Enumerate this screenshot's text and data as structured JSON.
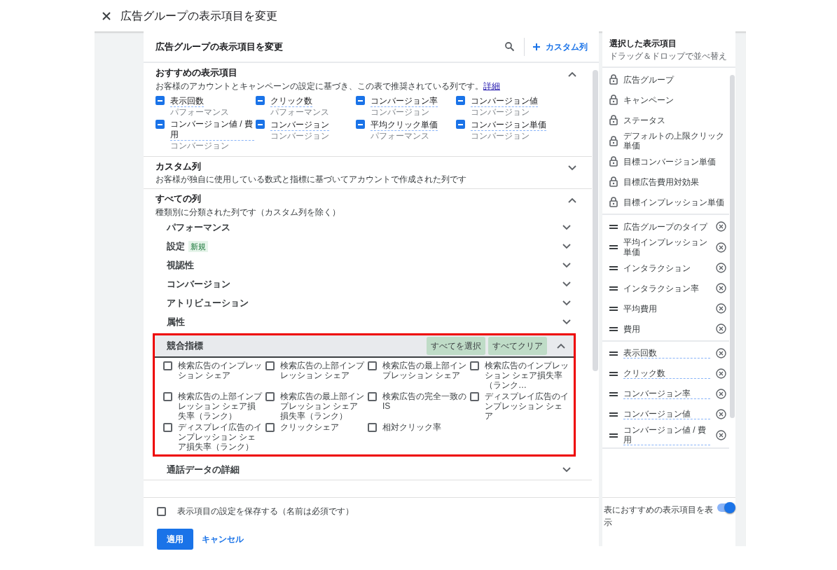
{
  "header": {
    "title": "広告グループの表示項目を変更"
  },
  "panel": {
    "title": "広告グループの表示項目を変更",
    "custom_column_button": "カスタム列"
  },
  "sections": [
    {
      "kind": "recommended",
      "title": "おすすめの表示項目",
      "description": "お客様のアカウントとキャンペーンの設定に基づき、この表で推奨されている列です。",
      "link": "詳細",
      "expanded": true,
      "items": [
        {
          "label": "表示回数",
          "category": "パフォーマンス",
          "checked": true
        },
        {
          "label": "クリック数",
          "category": "パフォーマンス",
          "checked": true
        },
        {
          "label": "コンバージョン率",
          "category": "コンバージョン",
          "checked": true
        },
        {
          "label": "コンバージョン値",
          "category": "コンバージョン",
          "checked": true
        },
        {
          "label": "コンバージョン値 / 費用",
          "category": "コンバージョン",
          "checked": true
        },
        {
          "label": "コンバージョン",
          "category": "コンバージョン",
          "checked": true
        },
        {
          "label": "平均クリック単価",
          "category": "パフォーマンス",
          "checked": true
        },
        {
          "label": "コンバージョン単価",
          "category": "コンバージョン",
          "checked": true
        }
      ]
    },
    {
      "kind": "plain",
      "title": "カスタム列",
      "description": "お客様が独自に使用している数式と指標に基づいてアカウントで作成された列です",
      "expanded": false
    },
    {
      "kind": "categories",
      "title": "すべての列",
      "description": "種類別に分類された列です（カスタム列を除く）",
      "expanded": true,
      "categories": [
        {
          "label": "パフォーマンス",
          "expanded": false
        },
        {
          "label": "設定",
          "badge": "新規",
          "expanded": false
        },
        {
          "label": "視認性",
          "expanded": false
        },
        {
          "label": "コンバージョン",
          "expanded": false
        },
        {
          "label": "アトリビューション",
          "expanded": false
        },
        {
          "label": "属性",
          "expanded": false
        },
        {
          "label": "競合指標",
          "expanded": true,
          "highlighted": true,
          "select_all": "すべてを選択",
          "clear_all": "すべてクリア",
          "items": [
            {
              "label": "検索広告のインプレッション シェア",
              "checked": false
            },
            {
              "label": "検索広告の上部インプレッション シェア",
              "checked": false
            },
            {
              "label": "検索広告の最上部インプレッション シェア",
              "checked": false
            },
            {
              "label": "検索広告のインプレッション シェア損失率（ランク…",
              "checked": false
            },
            {
              "label": "検索広告の上部インプレッション シェア損失率（ランク）",
              "checked": false
            },
            {
              "label": "検索広告の最上部インプレッション シェア損失率（ランク）",
              "checked": false
            },
            {
              "label": "検索広告の完全一致の IS",
              "checked": false
            },
            {
              "label": "ディスプレイ広告のインプレッション シェア",
              "checked": false
            },
            {
              "label": "ディスプレイ広告のインプレッション シェア損失率（ランク）",
              "checked": false
            },
            {
              "label": "クリックシェア",
              "checked": false
            },
            {
              "label": "相対クリック率",
              "checked": false
            }
          ]
        },
        {
          "label": "通話データの詳細",
          "expanded": false
        }
      ]
    }
  ],
  "footer": {
    "save": {
      "label": "表示項目の設定を保存する（名前は必須です）",
      "checked": false
    },
    "apply": "適用",
    "cancel": "キャンセル"
  },
  "selected_panel": {
    "title": "選択した表示項目",
    "subtitle": "ドラッグ＆ドロップで並べ替え",
    "groups": [
      {
        "kind": "locked",
        "items": [
          {
            "label": "広告グループ"
          },
          {
            "label": "キャンペーン"
          },
          {
            "label": "ステータス"
          },
          {
            "label": "デフォルトの上限クリック単価"
          },
          {
            "label": "目標コンバージョン単価"
          },
          {
            "label": "目標広告費用対効果"
          },
          {
            "label": "目標インプレッション単価"
          }
        ]
      },
      {
        "kind": "removable",
        "items": [
          {
            "label": "広告グループのタイプ"
          },
          {
            "label": "平均インプレッション単価"
          },
          {
            "label": "インタラクション"
          },
          {
            "label": "インタラクション率"
          },
          {
            "label": "平均費用"
          },
          {
            "label": "費用"
          }
        ]
      },
      {
        "kind": "recommended",
        "items": [
          {
            "label": "表示回数"
          },
          {
            "label": "クリック数"
          },
          {
            "label": "コンバージョン率"
          },
          {
            "label": "コンバージョン値"
          },
          {
            "label": "コンバージョン値 / 費用"
          }
        ]
      }
    ],
    "toggle": {
      "label": "表におすすめの表示項目を表示",
      "on": true
    }
  }
}
